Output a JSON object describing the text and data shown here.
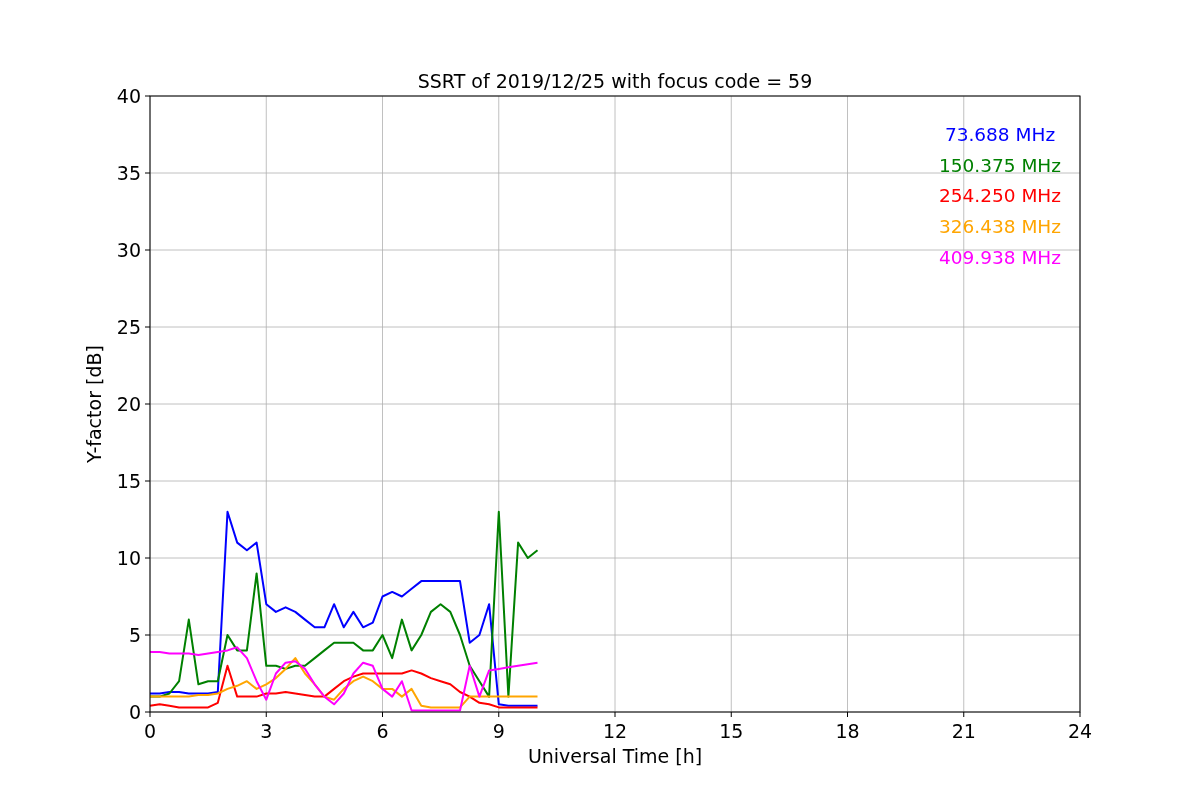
{
  "chart_data": {
    "type": "line",
    "title": "SSRT of 2019/12/25 with focus code = 59",
    "xlabel": "Universal Time [h]",
    "ylabel": "Y-factor [dB]",
    "x": [
      0,
      0.25,
      0.5,
      0.75,
      1,
      1.25,
      1.5,
      1.75,
      2,
      2.25,
      2.5,
      2.75,
      3,
      3.25,
      3.5,
      3.75,
      4,
      4.25,
      4.5,
      4.75,
      5,
      5.25,
      5.5,
      5.75,
      6,
      6.25,
      6.5,
      6.75,
      7,
      7.25,
      7.5,
      7.75,
      8,
      8.25,
      8.5,
      8.75,
      9,
      9.25,
      9.5,
      9.75,
      10
    ],
    "series": [
      {
        "name": "73.688 MHz",
        "color": "#0000ff",
        "values": [
          1.2,
          1.2,
          1.3,
          1.3,
          1.2,
          1.2,
          1.2,
          1.3,
          13,
          11,
          10.5,
          11,
          7,
          6.5,
          6.8,
          6.5,
          6,
          5.5,
          5.5,
          7,
          5.5,
          6.5,
          5.5,
          5.8,
          7.5,
          7.8,
          7.5,
          8,
          8.5,
          8.5,
          8.5,
          8.5,
          8.5,
          4.5,
          5,
          7,
          0.5,
          0.4,
          0.4,
          0.4,
          0.4
        ]
      },
      {
        "name": "150.375 MHz",
        "color": "#008000",
        "values": [
          1,
          1,
          1.2,
          2,
          6,
          1.8,
          2,
          2,
          5,
          4,
          4,
          9,
          3,
          3,
          2.8,
          3,
          3,
          3.5,
          4,
          4.5,
          4.5,
          4.5,
          4,
          4,
          5,
          3.5,
          6,
          4,
          5,
          6.5,
          7,
          6.5,
          5,
          3,
          2,
          1,
          13,
          1,
          11,
          10,
          10.5
        ]
      },
      {
        "name": "254.250 MHz",
        "color": "#ff0000",
        "values": [
          0.4,
          0.5,
          0.4,
          0.3,
          0.3,
          0.3,
          0.3,
          0.6,
          3,
          1,
          1,
          1,
          1.2,
          1.2,
          1.3,
          1.2,
          1.1,
          1,
          1,
          1.5,
          2,
          2.3,
          2.5,
          2.5,
          2.5,
          2.5,
          2.5,
          2.7,
          2.5,
          2.2,
          2,
          1.8,
          1.3,
          1,
          0.6,
          0.5,
          0.3,
          0.3,
          0.3,
          0.3,
          0.3
        ]
      },
      {
        "name": "326.438 MHz",
        "color": "#ffa500",
        "values": [
          1,
          1,
          1,
          1,
          1,
          1.1,
          1.1,
          1.2,
          1.5,
          1.7,
          2,
          1.5,
          1.8,
          2.2,
          2.8,
          3.5,
          2.5,
          1.8,
          1,
          0.8,
          1.5,
          2,
          2.3,
          2,
          1.5,
          1.5,
          1,
          1.5,
          0.4,
          0.3,
          0.3,
          0.3,
          0.3,
          1,
          1,
          1,
          1,
          1,
          1,
          1,
          1
        ]
      },
      {
        "name": "409.938 MHz",
        "color": "#ff00ff",
        "values": [
          3.9,
          3.9,
          3.8,
          3.8,
          3.8,
          3.7,
          3.8,
          3.9,
          4,
          4.2,
          3.5,
          2,
          0.8,
          2.5,
          3.2,
          3.3,
          2.8,
          1.8,
          1,
          0.5,
          1.2,
          2.5,
          3.2,
          3,
          1.5,
          1,
          2,
          0.1,
          0.1,
          0.1,
          0.1,
          0.1,
          0.1,
          3,
          1,
          2.7,
          2.8,
          2.9,
          3,
          3.1,
          3.2
        ]
      }
    ],
    "xlim": [
      0,
      24
    ],
    "ylim": [
      0,
      40
    ],
    "xticks": [
      0,
      3,
      6,
      9,
      12,
      15,
      18,
      21,
      24
    ],
    "yticks": [
      0,
      5,
      10,
      15,
      20,
      25,
      30,
      35,
      40
    ],
    "grid": true
  }
}
